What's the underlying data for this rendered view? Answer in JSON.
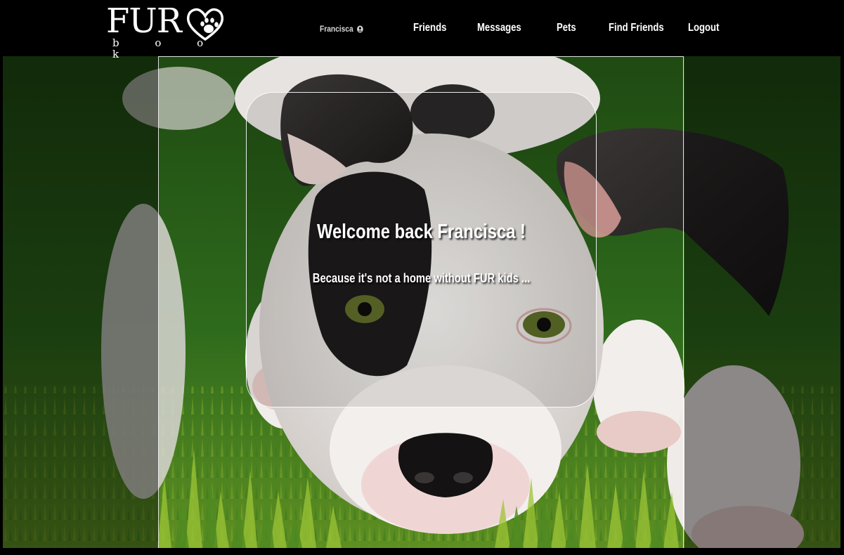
{
  "navbar": {
    "logo": {
      "word": "FUR",
      "tagline": "b o o k"
    },
    "username": "Francisca",
    "links": [
      {
        "label": "Friends"
      },
      {
        "label": "Messages"
      },
      {
        "label": "Pets"
      },
      {
        "label": "Find Friends"
      },
      {
        "label": "Logout"
      }
    ],
    "icons": {
      "user": "user-circle-icon",
      "logo": "heart-paw-icon"
    }
  },
  "hero": {
    "welcome_title": "Welcome back Francisca !",
    "welcome_subtitle": "Because it's not a home without FUR kids ..."
  },
  "colors": {
    "navbar_bg": "#000000",
    "text": "#ffffff",
    "grass": "#2f6d1e",
    "card_border": "#ffffff"
  }
}
